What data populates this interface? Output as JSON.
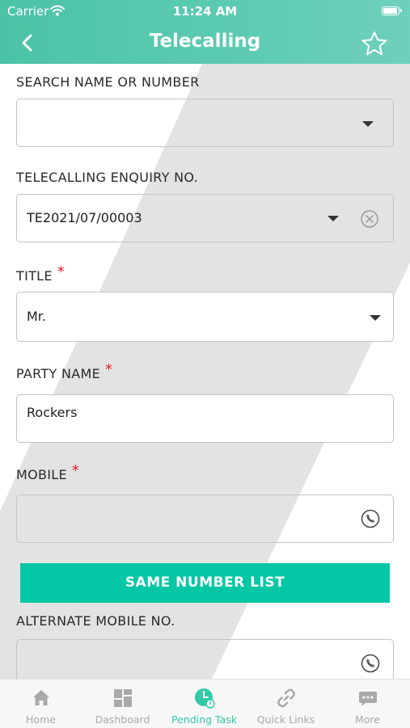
{
  "status_bar": {
    "carrier": "Carrier",
    "time": "11:24 AM"
  },
  "nav": {
    "title": "Telecalling"
  },
  "form": {
    "search": {
      "label": "SEARCH NAME OR NUMBER",
      "value": ""
    },
    "enquiry": {
      "label": "TELECALLING ENQUIRY NO.",
      "value": "TE2021/07/00003"
    },
    "title": {
      "label": "TITLE",
      "required_mark": "*",
      "value": "Mr."
    },
    "party_name": {
      "label": "PARTY NAME",
      "required_mark": "*",
      "value": "Rockers"
    },
    "mobile": {
      "label": "MOBILE",
      "required_mark": "*",
      "value": ""
    },
    "same_number_button": "SAME NUMBER LIST",
    "alternate_mobile": {
      "label": "ALTERNATE MOBILE NO.",
      "value": ""
    }
  },
  "tabbar": {
    "items": [
      {
        "label": "Home",
        "icon": "home-icon",
        "active": false
      },
      {
        "label": "Dashboard",
        "icon": "dashboard-icon",
        "active": false
      },
      {
        "label": "Pending Task",
        "icon": "pending-task-icon",
        "active": true
      },
      {
        "label": "Quick Links",
        "icon": "link-icon",
        "active": false
      },
      {
        "label": "More",
        "icon": "more-icon",
        "active": false
      }
    ]
  },
  "colors": {
    "header": "#5dcbb3",
    "accent": "#05c7a6",
    "required": "#e0202a",
    "tab_inactive": "#a9a9a9",
    "tab_active": "#33c9a8"
  }
}
